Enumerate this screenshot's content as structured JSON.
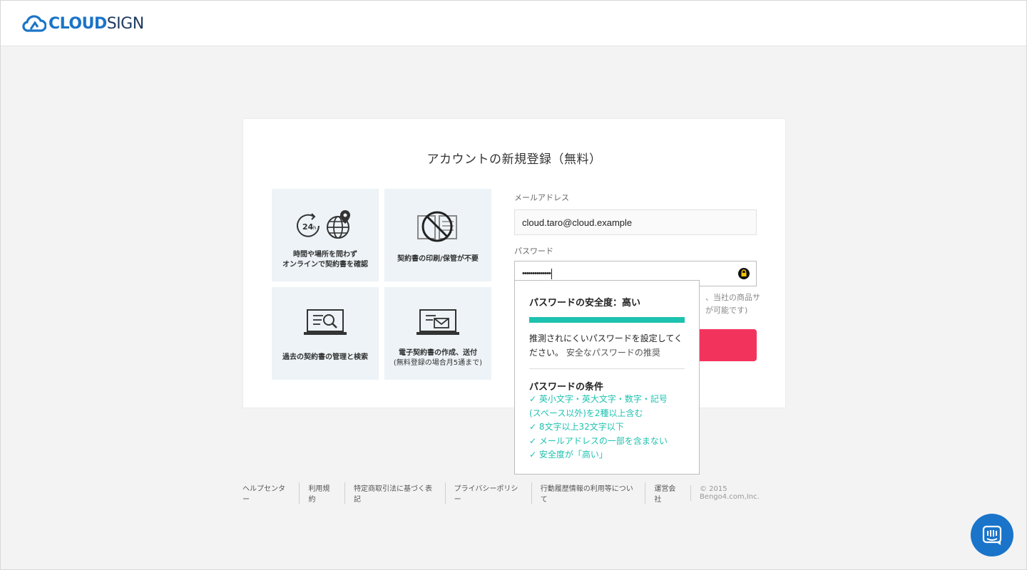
{
  "header": {
    "logo_cloud": "CLOUD",
    "logo_sign": "SIGN"
  },
  "card": {
    "title": "アカウントの新規登録（無料）",
    "tiles": [
      {
        "line1": "時間や場所を問わず",
        "line2": "オンラインで契約書を確認",
        "icon": "24h-globe-icon"
      },
      {
        "line1": "契約書の印刷/保管が不要",
        "icon": "no-paper-icon"
      },
      {
        "line1": "過去の契約書の管理と検索",
        "icon": "laptop-search-icon"
      },
      {
        "line1": "電子契約書の作成、送付",
        "line2": "(無料登録の場合月5通まで)",
        "icon": "laptop-mail-icon"
      }
    ]
  },
  "form": {
    "email_label": "メールアドレス",
    "email_value": "cloud.taro@cloud.example",
    "password_label": "パスワード",
    "password_value": "••••••••••••••",
    "hint_line1": "、当社の商品サ",
    "hint_line2": "が可能です)"
  },
  "popover": {
    "strength_heading": "パスワードの安全度：高い",
    "strength_level": 1.0,
    "desc_line1": "推測されにくいパスワードを設定してく",
    "desc_line2": "ださい。",
    "desc_link": "安全なパスワードの推奨",
    "cond_heading": "パスワードの条件",
    "cond_1a": "✓ 英小文字・英大文字・数字・記号",
    "cond_1b": "(スペース以外)を2種以上含む",
    "cond_2": "✓ 8文字以上32文字以下",
    "cond_3": "✓ メールアドレスの一部を含まない",
    "cond_4": "✓ 安全度が「高い」"
  },
  "footer": {
    "links": [
      "ヘルプセンター",
      "利用規約",
      "特定商取引法に基づく表記",
      "プライバシーポリシー",
      "行動履歴情報の利用等について",
      "運営会社"
    ],
    "copyright": "© 2015 Bengo4.com,Inc."
  },
  "colors": {
    "brand": "#1a74c9",
    "accent": "#f2345c",
    "success": "#1ec2b0"
  }
}
